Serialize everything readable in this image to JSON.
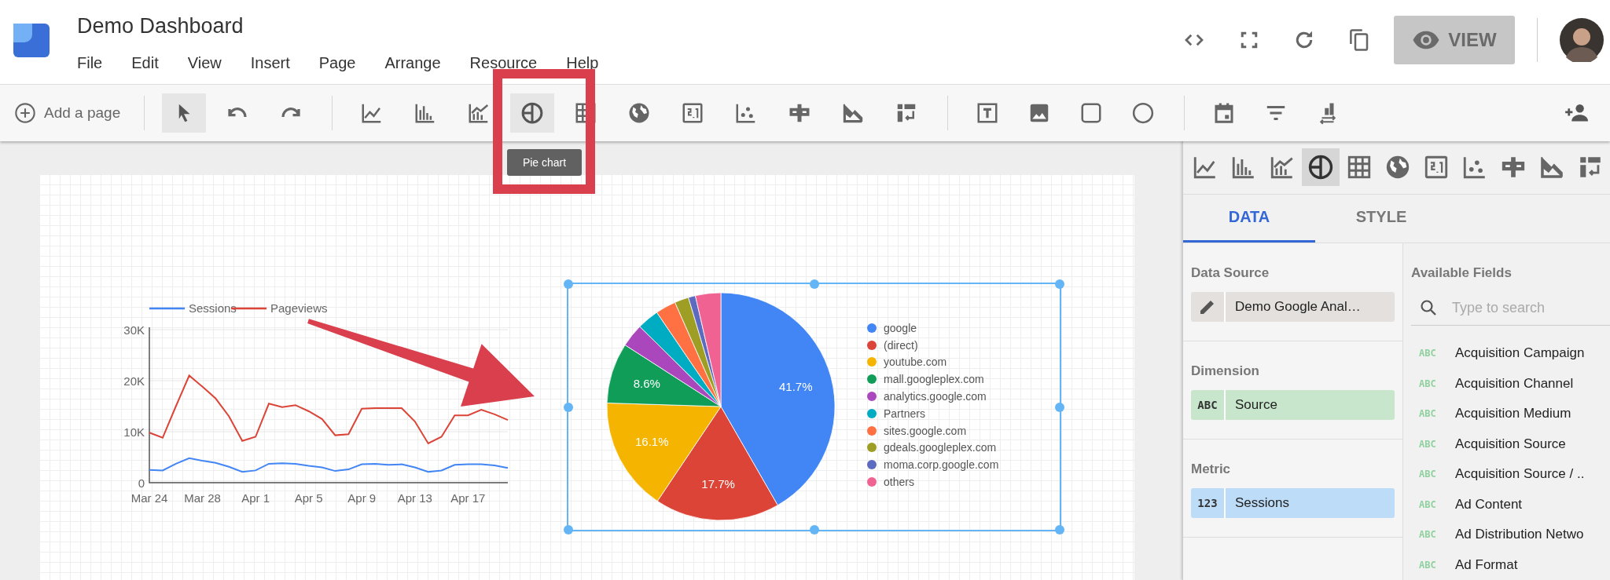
{
  "app": {
    "title": "Demo Dashboard",
    "menu": [
      "File",
      "Edit",
      "View",
      "Insert",
      "Page",
      "Arrange",
      "Resource",
      "Help"
    ],
    "view_button": "VIEW"
  },
  "header_actions": [
    {
      "kind": "embed"
    },
    {
      "kind": "fullscreen"
    },
    {
      "kind": "refresh"
    },
    {
      "kind": "copy"
    }
  ],
  "toolbar": {
    "add_page": "Add a page",
    "tooltip": "Pie chart",
    "groups": [
      [
        {
          "kind": "select",
          "selected": true
        },
        {
          "kind": "undo",
          "selected": false
        },
        {
          "kind": "redo",
          "selected": false
        }
      ],
      [
        {
          "kind": "line",
          "selected": false
        },
        {
          "kind": "bar",
          "selected": false
        },
        {
          "kind": "combo",
          "selected": false
        },
        {
          "kind": "pie",
          "selected": true
        },
        {
          "kind": "table",
          "selected": false
        },
        {
          "kind": "geo",
          "selected": false
        },
        {
          "kind": "scorecard",
          "selected": false
        },
        {
          "kind": "scatter",
          "selected": false
        },
        {
          "kind": "bullet",
          "selected": false
        },
        {
          "kind": "area",
          "selected": false
        },
        {
          "kind": "pivot",
          "selected": false
        }
      ],
      [
        {
          "kind": "text",
          "selected": false
        },
        {
          "kind": "image",
          "selected": false
        },
        {
          "kind": "rectangle",
          "selected": false
        },
        {
          "kind": "circle",
          "selected": false
        }
      ],
      [
        {
          "kind": "date",
          "selected": false
        },
        {
          "kind": "filter",
          "selected": false
        },
        {
          "kind": "datacontrol",
          "selected": false
        }
      ]
    ]
  },
  "canvas": {
    "line_chart": {
      "chart_data": {
        "type": "line",
        "legend": true,
        "categories": [
          "Mar 24",
          null,
          null,
          null,
          "Mar 28",
          null,
          null,
          null,
          "Apr 1",
          null,
          null,
          null,
          "Apr 5",
          null,
          null,
          null,
          "Apr 9",
          null,
          null,
          null,
          "Apr 13",
          null,
          null,
          null,
          "Apr 17",
          null,
          null,
          null
        ],
        "ylim": [
          0,
          30000
        ],
        "yticks": [
          0,
          {
            "value": 10000,
            "label": "10K"
          },
          {
            "value": 20000,
            "label": "20K"
          },
          {
            "value": 30000,
            "label": "30K"
          }
        ],
        "series": [
          {
            "name": "Sessions",
            "color": "#4285f4",
            "values": [
              2500,
              2400,
              3700,
              4800,
              4300,
              3900,
              3100,
              2100,
              2400,
              3700,
              3800,
              3700,
              3300,
              3000,
              2300,
              2600,
              3600,
              3700,
              3500,
              3600,
              3000,
              2100,
              2400,
              3500,
              3600,
              3600,
              3400,
              2900
            ]
          },
          {
            "name": "Pageviews",
            "color": "#db4437",
            "values": [
              9800,
              8800,
              15000,
              21000,
              18800,
              16500,
              13000,
              8200,
              9000,
              15500,
              14800,
              15200,
              14000,
              12500,
              9300,
              9500,
              14500,
              14600,
              14600,
              14600,
              12000,
              7700,
              9000,
              13200,
              13200,
              14300,
              13400,
              12300
            ]
          }
        ]
      }
    },
    "pie_chart": {
      "chart_data": {
        "type": "pie",
        "legend": true,
        "categories": [
          "google",
          "(direct)",
          "youtube.com",
          "mall.googleplex.com",
          "analytics.google.com",
          "Partners",
          "sites.google.com",
          "gdeals.googleplex.com",
          "moma.corp.google.com",
          "others"
        ],
        "values": [
          41.7,
          17.7,
          16.1,
          8.6,
          3.3,
          3.1,
          2.9,
          2.0,
          1.0,
          3.6
        ],
        "colors": [
          "#4285f4",
          "#db4437",
          "#f4b400",
          "#0f9d58",
          "#ab47bc",
          "#00acc1",
          "#ff7043",
          "#9e9d24",
          "#5c6bc0",
          "#f06292"
        ],
        "value_labels": [
          "41.7%",
          "17.7%",
          "16.1%",
          "8.6%",
          null,
          null,
          null,
          null,
          null,
          null
        ]
      }
    }
  },
  "panel": {
    "chart_types": [
      {
        "kind": "line",
        "selected": false
      },
      {
        "kind": "bar",
        "selected": false
      },
      {
        "kind": "combo",
        "selected": false
      },
      {
        "kind": "pie",
        "selected": true
      },
      {
        "kind": "table",
        "selected": false
      },
      {
        "kind": "geo",
        "selected": false
      },
      {
        "kind": "scorecard",
        "selected": false
      },
      {
        "kind": "scatter",
        "selected": false
      },
      {
        "kind": "bullet",
        "selected": false
      },
      {
        "kind": "area",
        "selected": false
      },
      {
        "kind": "pivot",
        "selected": false
      }
    ],
    "tabs": [
      {
        "label": "DATA",
        "selected": true
      },
      {
        "label": "STYLE",
        "selected": false
      }
    ],
    "data_source": {
      "label": "Data Source",
      "value": "Demo Google Anal…"
    },
    "dimension": {
      "label": "Dimension",
      "type": "ABC",
      "value": "Source"
    },
    "metric": {
      "label": "Metric",
      "type": "123",
      "value": "Sessions"
    },
    "available_fields": {
      "label": "Available Fields",
      "placeholder": "Type to search",
      "items": [
        {
          "type": "ABC",
          "name": "Acquisition Campaign"
        },
        {
          "type": "ABC",
          "name": "Acquisition Channel"
        },
        {
          "type": "ABC",
          "name": "Acquisition Medium"
        },
        {
          "type": "ABC",
          "name": "Acquisition Source"
        },
        {
          "type": "ABC",
          "name": "Acquisition Source / .."
        },
        {
          "type": "ABC",
          "name": "Ad Content"
        },
        {
          "type": "ABC",
          "name": "Ad Distribution Netwo"
        },
        {
          "type": "ABC",
          "name": "Ad Format"
        }
      ]
    }
  }
}
